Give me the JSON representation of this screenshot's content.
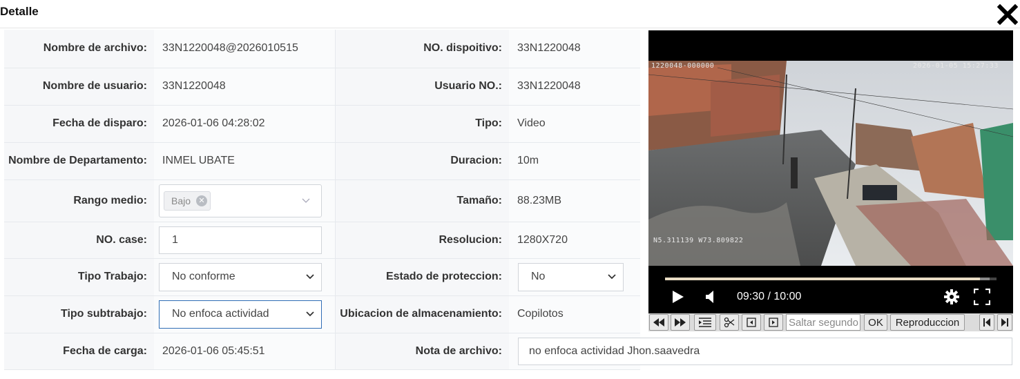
{
  "dialog": {
    "title": "Detalle"
  },
  "fields": {
    "file_name": {
      "label": "Nombre de archivo:",
      "value": "33N1220048@2026010515"
    },
    "device_no": {
      "label": "NO. dispoitivo:",
      "value": "33N1220048"
    },
    "user_name": {
      "label": "Nombre de usuario:",
      "value": "33N1220048"
    },
    "user_no": {
      "label": "Usuario NO.:",
      "value": "33N1220048"
    },
    "trigger_date": {
      "label": "Fecha de disparo:",
      "value": "2026-01-06 04:28:02"
    },
    "type": {
      "label": "Tipo:",
      "value": "Video"
    },
    "department": {
      "label": "Nombre de Departamento:",
      "value": "INMEL UBATE"
    },
    "duration": {
      "label": "Duracion:",
      "value": "10m"
    },
    "medium_range": {
      "label": "Rango medio:",
      "tag": "Bajo"
    },
    "size": {
      "label": "Tamaño:",
      "value": "88.23MB"
    },
    "case_no": {
      "label": "NO. case:",
      "value": "1"
    },
    "resolution": {
      "label": "Resolucion:",
      "value": "1280X720"
    },
    "work_type": {
      "label": "Tipo Trabajo:",
      "value": "No conforme"
    },
    "protection": {
      "label": "Estado de proteccion:",
      "value": "No"
    },
    "sub_work_type": {
      "label": "Tipo subtrabajo:",
      "value": "No enfoca actividad"
    },
    "storage": {
      "label": "Ubicacion de almacenamiento:",
      "value": "Copilotos"
    },
    "upload_date": {
      "label": "Fecha de carga:",
      "value": "2026-01-06 05:45:51"
    },
    "file_note": {
      "label": "Nota de archivo:",
      "value": "no enfoca actividad Jhon.saavedra"
    }
  },
  "player": {
    "osd_device": "1220048-000000",
    "osd_datetime": "2026-01-05 15:27:33",
    "osd_gps": "N5.311139 W73.809822",
    "time_display": "09:30 / 10:00",
    "progress": 0.95,
    "buffered": 0.98
  },
  "toolbar": {
    "seek_placeholder": "Saltar segundo",
    "ok_label": "OK",
    "playback_label": "Reproduccion"
  },
  "colors": {
    "accent_border": "#2f6db5",
    "label_bg": "#f6f7f9"
  }
}
